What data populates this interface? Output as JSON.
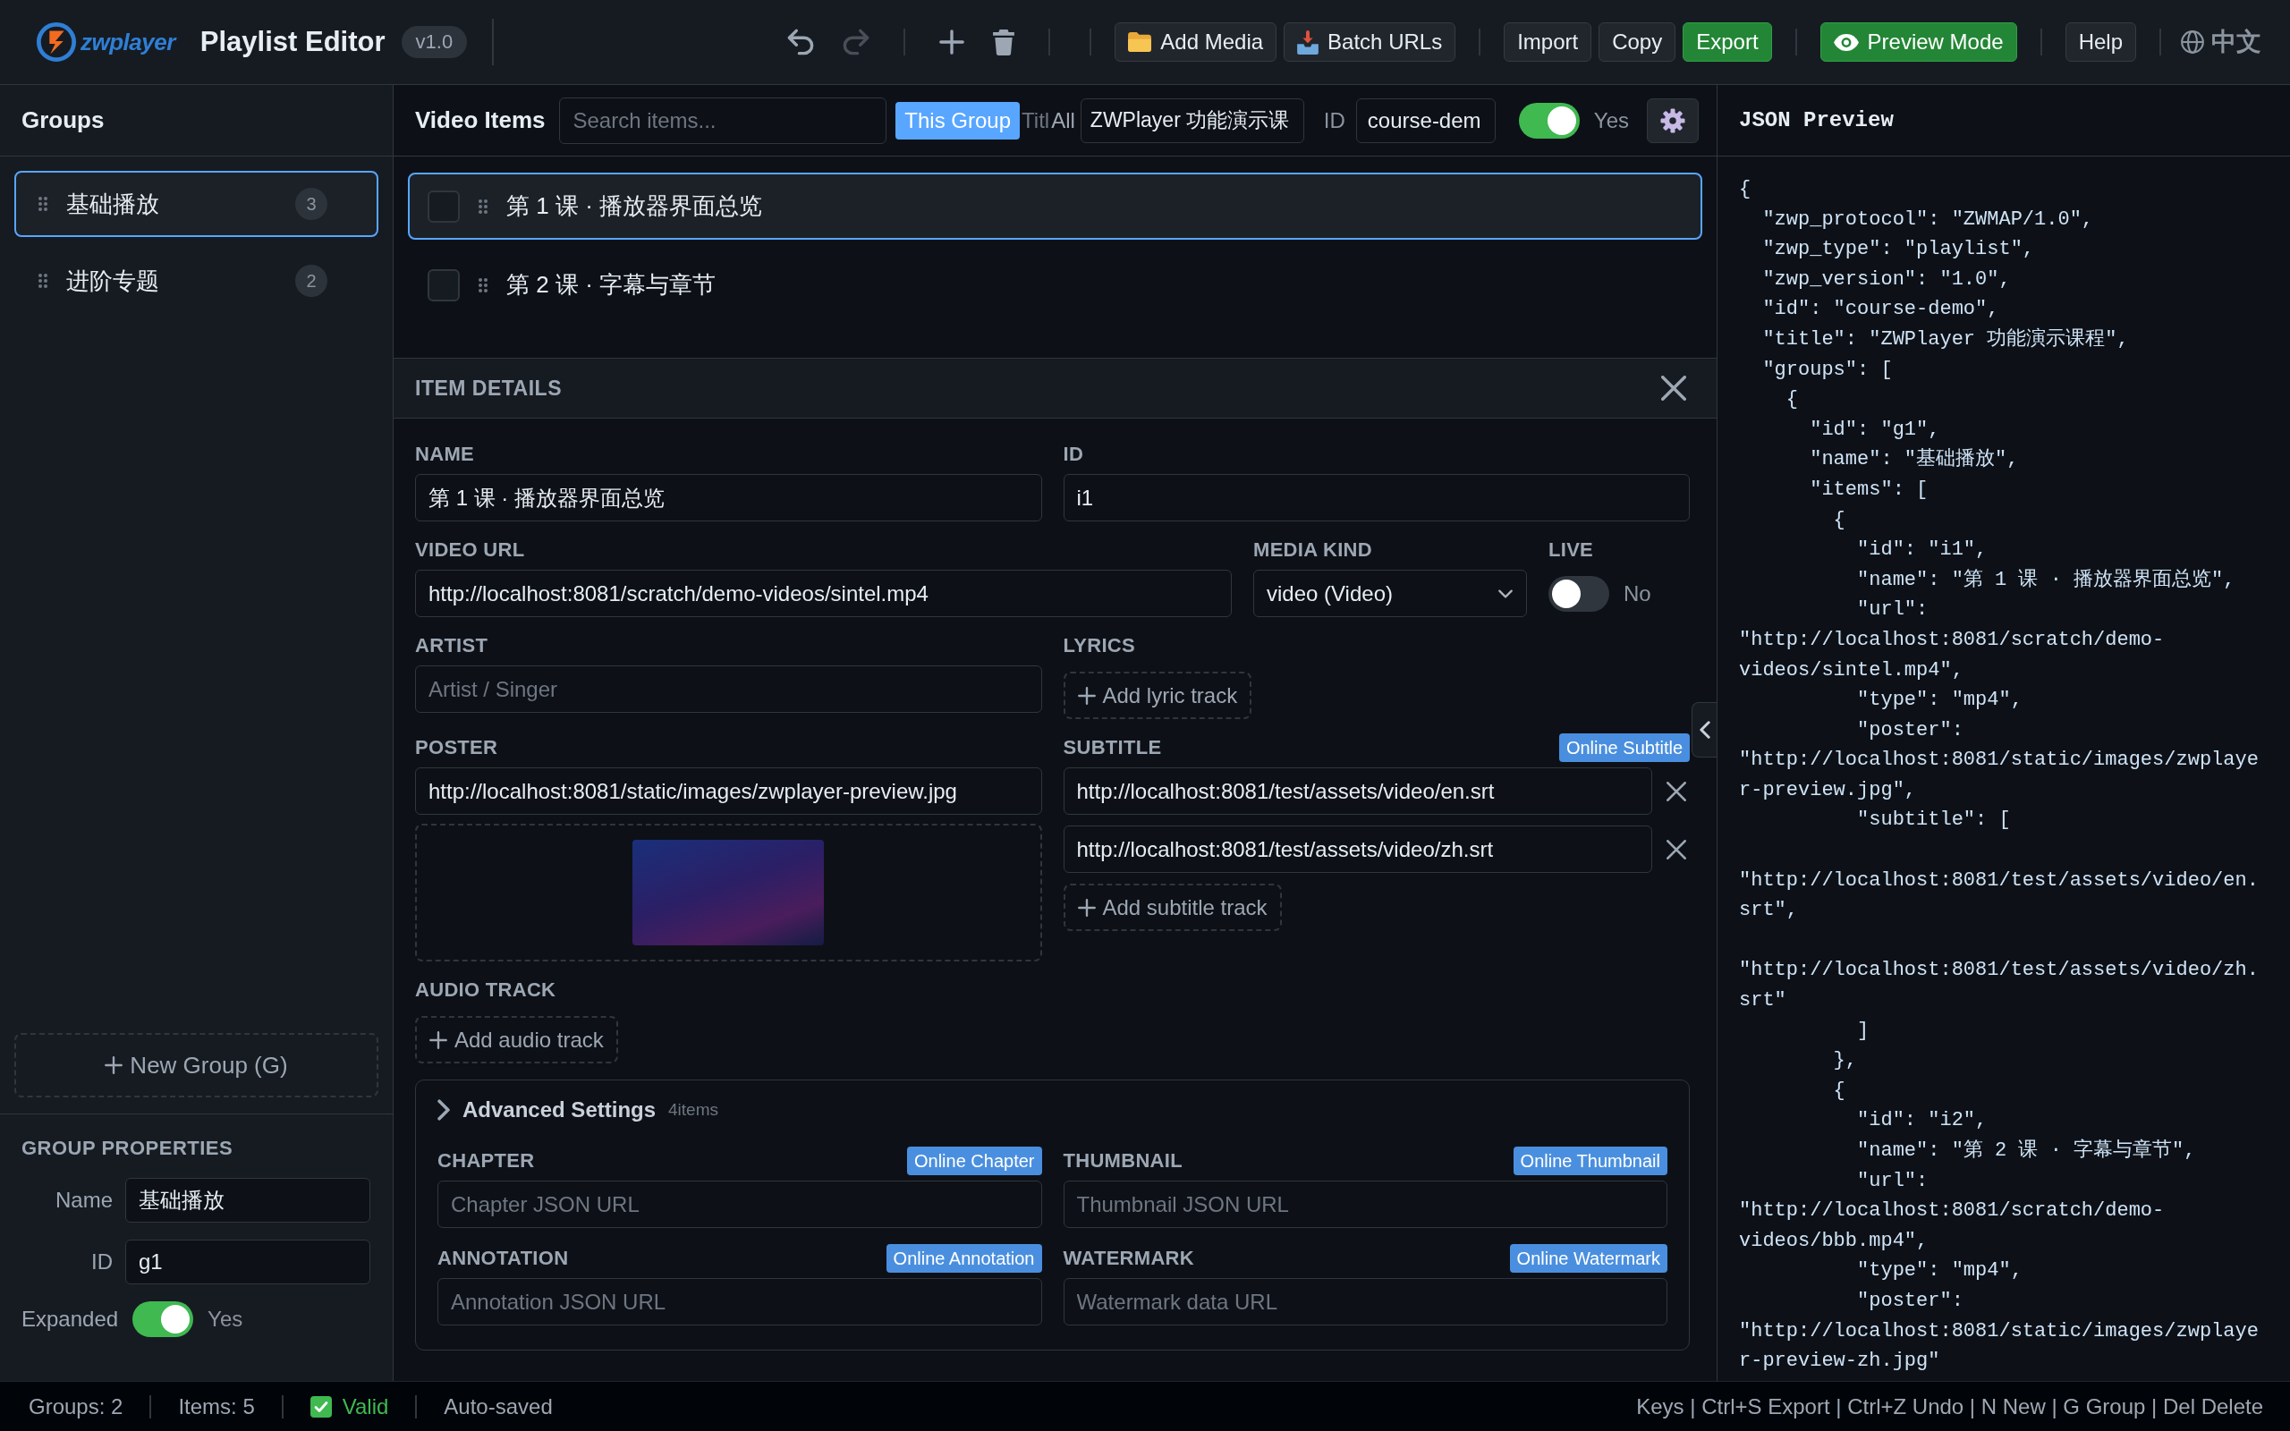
{
  "header": {
    "logo_text": "zwplayer",
    "title": "Playlist Editor",
    "version": "v1.0",
    "undo": {
      "disabled": false
    },
    "redo": {
      "disabled": true
    },
    "media_buttons": [
      "Add Media",
      "Batch URLs"
    ],
    "file_buttons": [
      {
        "label": "Import",
        "kind": "plain"
      },
      {
        "label": "Copy",
        "kind": "plain"
      },
      {
        "label": "Export",
        "kind": "primary"
      }
    ],
    "preview_button": {
      "label": "Preview Mode",
      "kind": "primary"
    },
    "help_button": "Help",
    "language": "中文"
  },
  "groups_panel": {
    "title": "Groups",
    "groups": [
      {
        "name": "基础播放",
        "count": "3",
        "selected": true
      },
      {
        "name": "进阶专题",
        "count": "2",
        "selected": false
      }
    ],
    "new_group_button": "New Group (G)"
  },
  "group_properties": {
    "title": "GROUP PROPERTIES",
    "fields": [
      {
        "label": "Name",
        "value": "基础播放"
      },
      {
        "label": "ID",
        "value": "g1"
      }
    ],
    "expanded": {
      "label": "Expanded",
      "on": true,
      "state_text": "Yes"
    }
  },
  "items_panel": {
    "title": "Video Items",
    "search": {
      "placeholder": "Search items..."
    },
    "scope_tabs": [
      {
        "label": "This Group",
        "selected": true
      },
      {
        "label": "All",
        "selected": false
      }
    ],
    "title_label": "Titl",
    "title_value": "ZWPlayer 功能演示课",
    "id_label": "ID",
    "id_value": "course-dem",
    "toggle": {
      "on": true,
      "state_text": "Yes"
    },
    "items": [
      {
        "name": "第 1 课 · 播放器界面总览",
        "checked": false,
        "selected": true
      },
      {
        "name": "第 2 课 · 字幕与章节",
        "checked": false,
        "selected": false
      }
    ]
  },
  "item_details": {
    "title": "ITEM DETAILS",
    "name_field": {
      "label": "NAME",
      "value": "第 1 课 · 播放器界面总览"
    },
    "id_field": {
      "label": "ID",
      "value": "i1"
    },
    "video_url": {
      "label": "VIDEO URL",
      "value": "http://localhost:8081/scratch/demo-videos/sintel.mp4"
    },
    "media_kind": {
      "label": "MEDIA KIND",
      "value": "video (Video)"
    },
    "live": {
      "label": "LIVE",
      "on": false,
      "state_text": "No"
    },
    "artist": {
      "label": "ARTIST",
      "placeholder": "Artist / Singer"
    },
    "lyrics": {
      "label": "LYRICS",
      "add_button": "Add lyric track"
    },
    "poster": {
      "label": "POSTER",
      "value": "http://localhost:8081/static/images/zwplayer-preview.jpg"
    },
    "subtitle": {
      "label": "SUBTITLE",
      "online_button": "Online Subtitle",
      "tracks": [
        "http://localhost:8081/test/assets/video/en.srt",
        "http://localhost:8081/test/assets/video/zh.srt"
      ],
      "add_button": "Add subtitle track"
    },
    "audio_track": {
      "label": "AUDIO TRACK",
      "add_button": "Add audio track"
    },
    "advanced": {
      "title": "Advanced Settings",
      "count": "4items",
      "fields": [
        {
          "label": "CHAPTER",
          "online_button": "Online Chapter",
          "placeholder": "Chapter JSON URL"
        },
        {
          "label": "THUMBNAIL",
          "online_button": "Online Thumbnail",
          "placeholder": "Thumbnail JSON URL"
        },
        {
          "label": "ANNOTATION",
          "online_button": "Online Annotation",
          "placeholder": "Annotation JSON URL"
        },
        {
          "label": "WATERMARK",
          "online_button": "Online Watermark",
          "placeholder": "Watermark data URL"
        }
      ]
    }
  },
  "json_preview": {
    "title": "JSON Preview",
    "code": "{\n  \"zwp_protocol\": \"ZWMAP/1.0\",\n  \"zwp_type\": \"playlist\",\n  \"zwp_version\": \"1.0\",\n  \"id\": \"course-demo\",\n  \"title\": \"ZWPlayer 功能演示课程\",\n  \"groups\": [\n    {\n      \"id\": \"g1\",\n      \"name\": \"基础播放\",\n      \"items\": [\n        {\n          \"id\": \"i1\",\n          \"name\": \"第 1 课 · 播放器界面总览\",\n          \"url\":\n\"http://localhost:8081/scratch/demo-\nvideos/sintel.mp4\",\n          \"type\": \"mp4\",\n          \"poster\":\n\"http://localhost:8081/static/images/zwplaye\nr-preview.jpg\",\n          \"subtitle\": [\n\n\"http://localhost:8081/test/assets/video/en.\nsrt\",\n\n\"http://localhost:8081/test/assets/video/zh.\nsrt\"\n          ]\n        },\n        {\n          \"id\": \"i2\",\n          \"name\": \"第 2 课 · 字幕与章节\",\n          \"url\":\n\"http://localhost:8081/scratch/demo-\nvideos/bbb.mp4\",\n          \"type\": \"mp4\",\n          \"poster\":\n\"http://localhost:8081/static/images/zwplaye\nr-preview-zh.jpg\""
  },
  "status_bar": {
    "groups": "Groups: 2",
    "items": "Items: 5",
    "validity": {
      "text": "Valid",
      "valid": true
    },
    "save_state": "Auto-saved",
    "shortcuts": "Keys | Ctrl+S Export | Ctrl+Z Undo | N New | G Group | Del Delete"
  }
}
